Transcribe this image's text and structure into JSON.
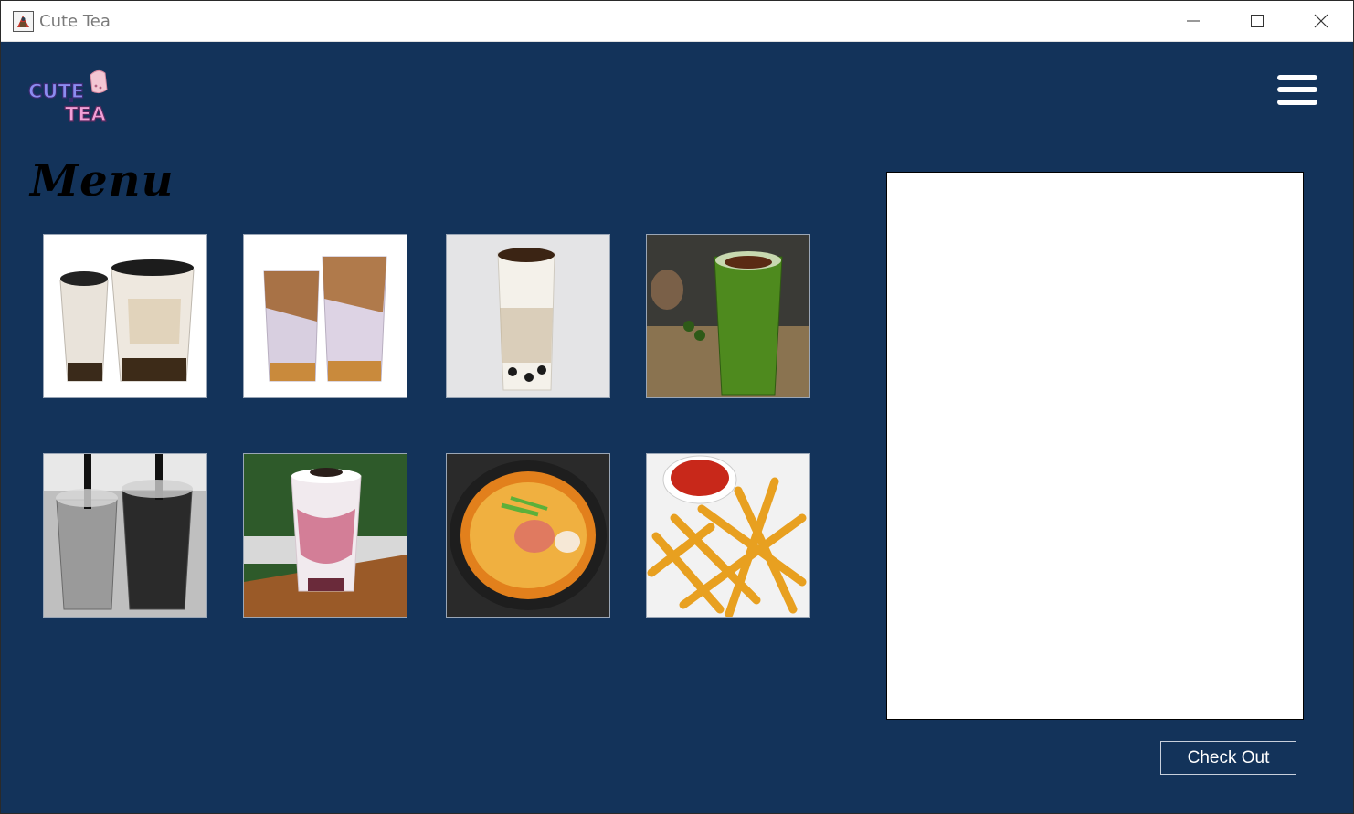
{
  "window": {
    "title": "Cute Tea",
    "icon": "java-app-icon"
  },
  "header": {
    "logo_text_line1": "CUTE",
    "logo_text_line2": "TEA",
    "menu_icon": "hamburger-icon"
  },
  "menu": {
    "title": "Menu",
    "items": [
      {
        "image": "milk-tea-two-cups"
      },
      {
        "image": "brown-sugar-milk-tea-two-cups"
      },
      {
        "image": "oreo-milk-tea-tall-cup"
      },
      {
        "image": "matcha-boba-tea"
      },
      {
        "image": "black-tea-two-cups"
      },
      {
        "image": "strawberry-oreo-smoothie"
      },
      {
        "image": "spicy-ramen-bowl"
      },
      {
        "image": "french-fries-with-ketchup"
      }
    ]
  },
  "order": {
    "checkout_label": "Check Out"
  },
  "colors": {
    "background": "#13335a",
    "panel": "#ffffff",
    "title_text": "#000000"
  }
}
